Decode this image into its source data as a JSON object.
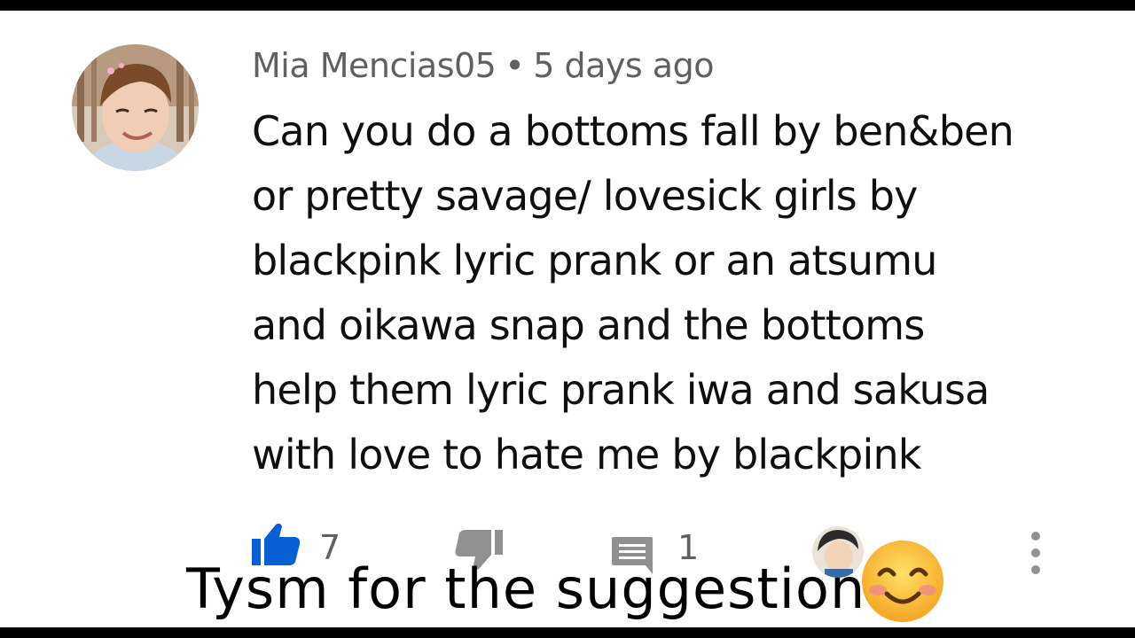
{
  "comment": {
    "author": "Mia Mencias05",
    "separator": "•",
    "timestamp": "5 days ago",
    "lines": [
      "Can you do a bottoms fall by ben&ben",
      "or pretty savage/ lovesick girls by",
      "blackpink  lyric prank or an atsumu",
      "and oikawa snap and the bottoms",
      "help them lyric prank iwa and sakusa",
      "with love to hate me by blackpink"
    ]
  },
  "actions": {
    "like_count": "7",
    "reply_count": "1",
    "like_icon": "thumbs-up-filled-icon",
    "dislike_icon": "thumbs-down-icon",
    "reply_icon": "comment-icon",
    "more_icon": "more-vertical-icon"
  },
  "overlay": {
    "caption": "Tysm for the suggestion",
    "emoji": "smiling-face-emoji"
  },
  "colors": {
    "accent_blue": "#065fd4",
    "muted_text": "#606060",
    "body_text": "#0f0f0f",
    "icon_gray": "#909090"
  }
}
